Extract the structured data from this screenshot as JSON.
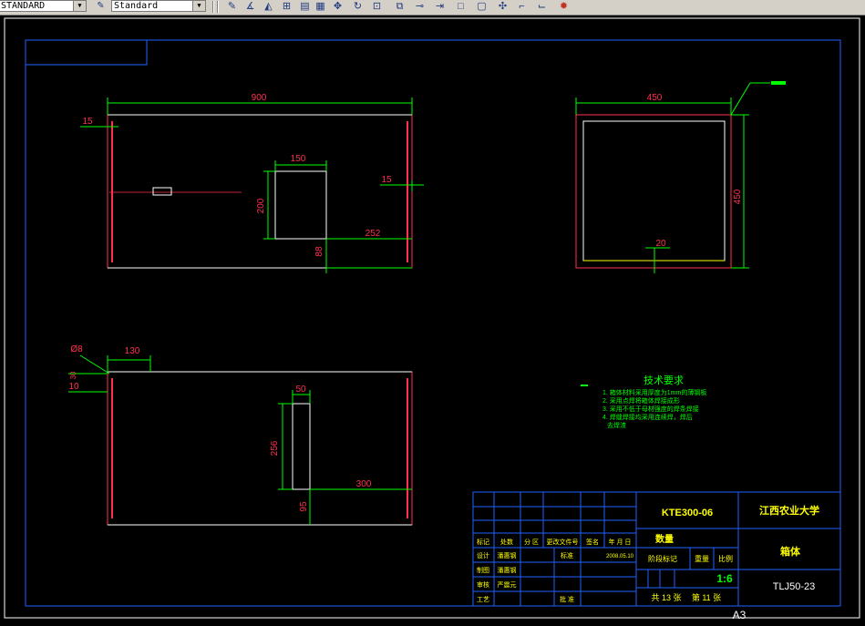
{
  "toolbar": {
    "text_style": "STANDARD",
    "dim_style": "Standard",
    "buttons": [
      "dimension-icon",
      "angular-icon",
      "arc-icon",
      "align-icon",
      "grid-icon",
      "move-icon",
      "rotate-icon",
      "scale-icon",
      "mirror-icon",
      "break-icon",
      "extend-icon",
      "rectangle-icon",
      "square-icon",
      "trim-icon",
      "chamfer-icon",
      "explode-icon"
    ]
  },
  "drawing": {
    "front_view": {
      "width": "900",
      "left_margin": "15",
      "right_margin": "15",
      "hole_width": "150",
      "hole_height": "200",
      "hole_offset_right": "252",
      "hole_offset_bottom": "88"
    },
    "side_view": {
      "width": "450",
      "height": "450",
      "wall": "20"
    },
    "top_view": {
      "diameter": "Ø8",
      "offset": "130",
      "dim_a": "30",
      "dim_b": "10",
      "slot_width": "50",
      "slot_height": "256",
      "slot_offset_right": "300",
      "slot_offset_bottom": "95"
    }
  },
  "notes": {
    "title": "技术要求",
    "items": [
      "1. 箱体材料采用厚度为1mm的薄钢板",
      "2. 采用点焊将箱体焊接成形",
      "3. 采用不低于母材强度的焊条焊接",
      "4. 焊缝焊接均采用连续焊，焊后",
      "去焊渣"
    ]
  },
  "title_block": {
    "drawing_number": "KTE300-06",
    "school": "江西农业大学",
    "part_name": "箱体",
    "material": "TLJ50-23",
    "scale": "1:6",
    "quantity_label": "数量",
    "stage_label": "阶段标记",
    "weight_label": "重量",
    "scale_label": "比例",
    "total_sheets": "共 13 张",
    "sheet_no": "第 11 张",
    "sheet_size": "A3",
    "rows": [
      {
        "mark": "标记",
        "count": "处数",
        "zone": "分 区",
        "doc": "更改文件号",
        "sign": "签名",
        "date": "年 月 日"
      },
      {
        "mark": "设计",
        "name": "潘惠钢",
        "std": "标准",
        "date": "2008.05.10"
      },
      {
        "mark": "制图",
        "name": "潘惠钢"
      },
      {
        "mark": "审核",
        "name": "严震元"
      },
      {
        "mark": "工艺",
        "approve": "批 准"
      }
    ]
  }
}
